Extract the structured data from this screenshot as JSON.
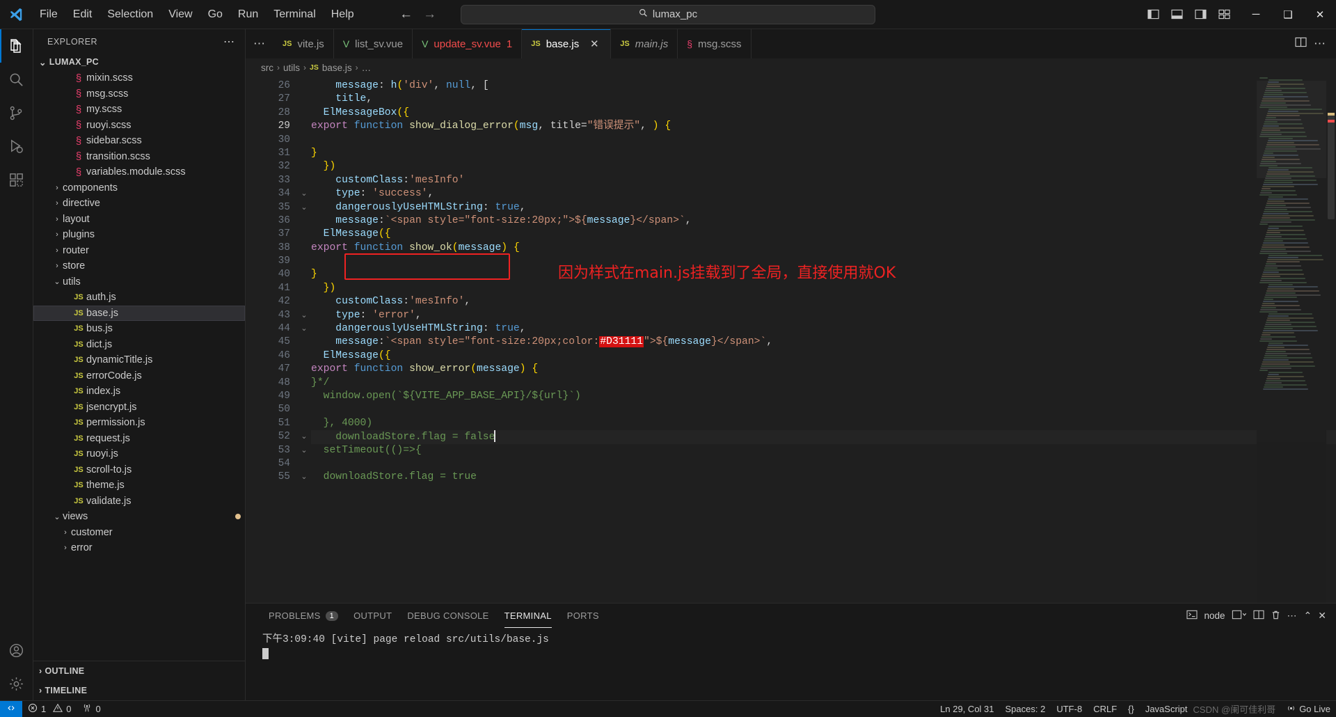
{
  "titlebar": {
    "menus": [
      "File",
      "Edit",
      "Selection",
      "View",
      "Go",
      "Run",
      "Terminal",
      "Help"
    ],
    "command_center_text": "lumax_pc",
    "back_arrow": "←",
    "forward_arrow": "→",
    "minimize": "─",
    "maximize": "❑",
    "close": "✕"
  },
  "activitybar": {
    "items": [
      {
        "name": "explorer",
        "icon": "files-icon",
        "active": true
      },
      {
        "name": "search",
        "icon": "search-icon",
        "active": false
      },
      {
        "name": "source-control",
        "icon": "source-control-icon",
        "active": false
      },
      {
        "name": "run-debug",
        "icon": "run-debug-icon",
        "active": false
      },
      {
        "name": "extensions",
        "icon": "extensions-icon",
        "active": false
      }
    ],
    "bottom": [
      {
        "name": "accounts",
        "icon": "account-icon"
      },
      {
        "name": "settings",
        "icon": "gear-icon"
      }
    ]
  },
  "sidebar": {
    "header_title": "EXPLORER",
    "more_actions": "⋯",
    "root_label": "LUMAX_PC",
    "tree": [
      {
        "label": "mixin.scss",
        "indent": 3,
        "type": "scss",
        "kind": "file"
      },
      {
        "label": "msg.scss",
        "indent": 3,
        "type": "scss",
        "kind": "file"
      },
      {
        "label": "my.scss",
        "indent": 3,
        "type": "scss",
        "kind": "file"
      },
      {
        "label": "ruoyi.scss",
        "indent": 3,
        "type": "scss",
        "kind": "file"
      },
      {
        "label": "sidebar.scss",
        "indent": 3,
        "type": "scss",
        "kind": "file"
      },
      {
        "label": "transition.scss",
        "indent": 3,
        "type": "scss",
        "kind": "file"
      },
      {
        "label": "variables.module.scss",
        "indent": 3,
        "type": "scss",
        "kind": "file"
      },
      {
        "label": "components",
        "indent": 2,
        "kind": "folder",
        "expanded": false
      },
      {
        "label": "directive",
        "indent": 2,
        "kind": "folder",
        "expanded": false
      },
      {
        "label": "layout",
        "indent": 2,
        "kind": "folder",
        "expanded": false
      },
      {
        "label": "plugins",
        "indent": 2,
        "kind": "folder",
        "expanded": false
      },
      {
        "label": "router",
        "indent": 2,
        "kind": "folder",
        "expanded": false
      },
      {
        "label": "store",
        "indent": 2,
        "kind": "folder",
        "expanded": false
      },
      {
        "label": "utils",
        "indent": 2,
        "kind": "folder",
        "expanded": true
      },
      {
        "label": "auth.js",
        "indent": 3,
        "type": "js",
        "kind": "file"
      },
      {
        "label": "base.js",
        "indent": 3,
        "type": "js",
        "kind": "file",
        "selected": true
      },
      {
        "label": "bus.js",
        "indent": 3,
        "type": "js",
        "kind": "file"
      },
      {
        "label": "dict.js",
        "indent": 3,
        "type": "js",
        "kind": "file"
      },
      {
        "label": "dynamicTitle.js",
        "indent": 3,
        "type": "js",
        "kind": "file"
      },
      {
        "label": "errorCode.js",
        "indent": 3,
        "type": "js",
        "kind": "file"
      },
      {
        "label": "index.js",
        "indent": 3,
        "type": "js",
        "kind": "file"
      },
      {
        "label": "jsencrypt.js",
        "indent": 3,
        "type": "js",
        "kind": "file"
      },
      {
        "label": "permission.js",
        "indent": 3,
        "type": "js",
        "kind": "file"
      },
      {
        "label": "request.js",
        "indent": 3,
        "type": "js",
        "kind": "file"
      },
      {
        "label": "ruoyi.js",
        "indent": 3,
        "type": "js",
        "kind": "file"
      },
      {
        "label": "scroll-to.js",
        "indent": 3,
        "type": "js",
        "kind": "file"
      },
      {
        "label": "theme.js",
        "indent": 3,
        "type": "js",
        "kind": "file"
      },
      {
        "label": "validate.js",
        "indent": 3,
        "type": "js",
        "kind": "file"
      },
      {
        "label": "views",
        "indent": 2,
        "kind": "folder",
        "expanded": true,
        "modified": true
      },
      {
        "label": "customer",
        "indent": 3,
        "kind": "folder",
        "expanded": false
      },
      {
        "label": "error",
        "indent": 3,
        "kind": "folder",
        "expanded": false
      }
    ],
    "outline_label": "OUTLINE",
    "timeline_label": "TIMELINE"
  },
  "tabs": {
    "overflow": "⋯",
    "items": [
      {
        "label": "vite.js",
        "type": "js",
        "active": false,
        "italic": false,
        "error": false
      },
      {
        "label": "list_sv.vue",
        "type": "vue",
        "active": false,
        "italic": false,
        "error": false
      },
      {
        "label": "update_sv.vue",
        "type": "vue",
        "active": false,
        "italic": false,
        "error": true,
        "errcount": "1"
      },
      {
        "label": "base.js",
        "type": "js",
        "active": true,
        "italic": false,
        "error": false,
        "close": "✕"
      },
      {
        "label": "main.js",
        "type": "js",
        "active": false,
        "italic": true,
        "error": false
      },
      {
        "label": "msg.scss",
        "type": "scss",
        "active": false,
        "italic": false,
        "error": false
      }
    ],
    "split_editor_icon": "split-editor-icon",
    "more_actions_icon": "more-actions-icon"
  },
  "breadcrumb": {
    "parts": [
      "src",
      "utils",
      "base.js",
      "…"
    ],
    "separator": "›"
  },
  "editor": {
    "first_line_number": 26,
    "lines": [
      {
        "n": 26,
        "fold": "",
        "current": false
      },
      {
        "n": 27,
        "fold": "",
        "current": false
      },
      {
        "n": 28,
        "fold": "",
        "current": false
      },
      {
        "n": 29,
        "fold": "",
        "current": true
      },
      {
        "n": 30,
        "fold": "",
        "current": false
      },
      {
        "n": 31,
        "fold": "",
        "current": false
      },
      {
        "n": 32,
        "fold": "",
        "current": false
      },
      {
        "n": 33,
        "fold": "",
        "current": false
      },
      {
        "n": 34,
        "fold": "⌄",
        "current": false
      },
      {
        "n": 35,
        "fold": "⌄",
        "current": false
      },
      {
        "n": 36,
        "fold": "",
        "current": false
      },
      {
        "n": 37,
        "fold": "",
        "current": false
      },
      {
        "n": 38,
        "fold": "",
        "current": false
      },
      {
        "n": 39,
        "fold": "",
        "current": false
      },
      {
        "n": 40,
        "fold": "",
        "current": false
      },
      {
        "n": 41,
        "fold": "",
        "current": false
      },
      {
        "n": 42,
        "fold": "",
        "current": false
      },
      {
        "n": 43,
        "fold": "⌄",
        "current": false
      },
      {
        "n": 44,
        "fold": "⌄",
        "current": false
      },
      {
        "n": 45,
        "fold": "",
        "current": false
      },
      {
        "n": 46,
        "fold": "",
        "current": false
      },
      {
        "n": 47,
        "fold": "",
        "current": false
      },
      {
        "n": 48,
        "fold": "",
        "current": false
      },
      {
        "n": 49,
        "fold": "",
        "current": false
      },
      {
        "n": 50,
        "fold": "",
        "current": false
      },
      {
        "n": 51,
        "fold": "",
        "current": false
      },
      {
        "n": 52,
        "fold": "⌄",
        "current": false
      },
      {
        "n": 53,
        "fold": "⌄",
        "current": false
      },
      {
        "n": 54,
        "fold": "",
        "current": false
      },
      {
        "n": 55,
        "fold": "⌄",
        "current": false
      }
    ],
    "code_text": [
      "  downloadStore.flag = true",
      "",
      "  setTimeout(()=>{",
      "    downloadStore.flag = false",
      "  }, 4000)",
      "",
      "  window.open(`${VITE_APP_BASE_API}/${url}`)",
      "}*/",
      "export function show_error(message) {",
      "  ElMessage({",
      "    message:`<span style=\"font-size:20px;color:#D31111\">${message}</span>`,",
      "    dangerouslyUseHTMLString: true,",
      "    type: 'error',",
      "    customClass:'mesInfo',",
      "  })",
      "}",
      "",
      "export function show_ok(message) {",
      "  ElMessage({",
      "    message:`<span style=\"font-size:20px;\">${message}</span>`,",
      "    dangerouslyUseHTMLString: true,",
      "    type: 'success',",
      "    customClass:'mesInfo'",
      "  })",
      "}",
      "",
      "export function show_dialog_error(msg, title=\"错误提示\", ) {",
      "  ElMessageBox({",
      "    title,",
      "    message: h('div', null, ["
    ],
    "color_swatch_value": "#D31111",
    "annotation_text": "因为样式在main.js挂载到了全局，直接使用就OK",
    "annotation_color": "#ee2222"
  },
  "panel": {
    "tabs": [
      {
        "label": "PROBLEMS",
        "badge": "1",
        "active": false
      },
      {
        "label": "OUTPUT",
        "badge": "",
        "active": false
      },
      {
        "label": "DEBUG CONSOLE",
        "badge": "",
        "active": false
      },
      {
        "label": "TERMINAL",
        "badge": "",
        "active": true
      },
      {
        "label": "PORTS",
        "badge": "",
        "active": false
      }
    ],
    "terminal_chip": "node",
    "actions": {
      "new_terminal": "new-terminal-icon",
      "split_terminal": "split-terminal-icon",
      "kill_terminal": "trash-icon",
      "more": "⋯",
      "maximize": "⌃",
      "close": "✕"
    },
    "terminal_output": "下午3:09:40 [vite] page reload src/utils/base.js"
  },
  "statusbar": {
    "remote_label": "",
    "errors": "1",
    "warnings": "0",
    "ports": "0",
    "cursor_position": "Ln 29, Col 31",
    "indentation": "Spaces: 2",
    "encoding": "UTF-8",
    "eol": "CRLF",
    "language": "JavaScript",
    "prettier": "{}",
    "go_live": "Go Live",
    "watermark": "CSDN @阑可佳利哥"
  }
}
